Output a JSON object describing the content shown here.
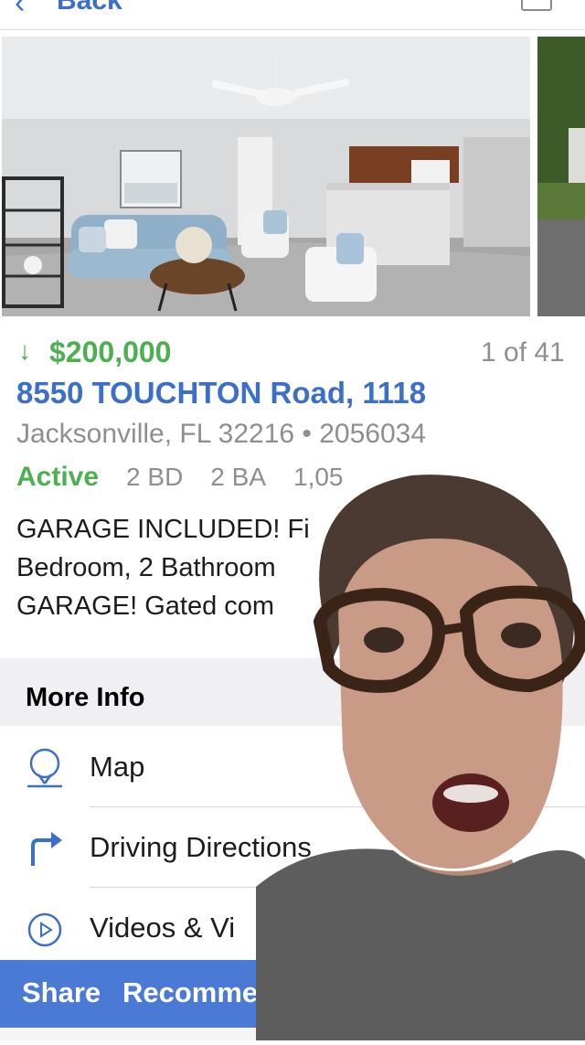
{
  "header": {
    "back_label": "Back"
  },
  "listing": {
    "price": "$200,000",
    "photo_counter": "1 of 41",
    "address": "8550 TOUCHTON Road, 1118",
    "city_line": "Jacksonville, FL 32216 • 2056034",
    "status": "Active",
    "beds": "2 BD",
    "baths": "2 BA",
    "sqft": "1,05",
    "description_lines": [
      "GARAGE INCLUDED! Fi",
      "Bedroom, 2 Bathroom",
      "GARAGE! Gated com"
    ]
  },
  "more_info": {
    "title": "More Info",
    "items": [
      {
        "label": "Map",
        "icon": "map-pin-icon"
      },
      {
        "label": "Driving Directions",
        "icon": "turn-right-arrow-icon"
      },
      {
        "label": "Videos & Vi",
        "icon": "play-circle-icon"
      }
    ]
  },
  "actions": {
    "share": "Share",
    "recommend": "Recommend"
  },
  "colors": {
    "accent_blue": "#3b6fc9",
    "status_green": "#4caf50",
    "action_bar": "#4a7ad6",
    "muted_gray": "#8e8e93"
  }
}
